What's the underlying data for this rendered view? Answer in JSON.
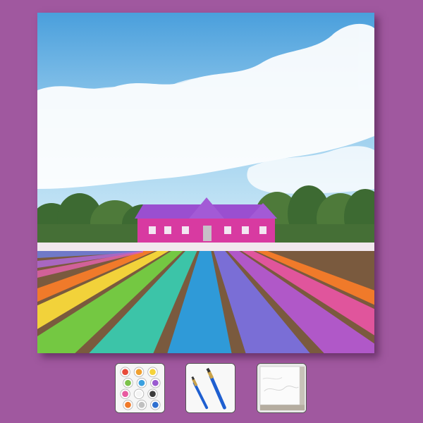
{
  "colors": {
    "background": "#a0589f",
    "sky_top": "#4fa6e0",
    "sky_bottom": "#bfe2f7",
    "house_wall": "#d83aa1",
    "house_roof": "#9a4fd0"
  },
  "main_image": {
    "subject": "house-with-rainbow-flower-field-icon",
    "stripe_colors": [
      "#f07a2a",
      "#f2d23a",
      "#74c842",
      "#3cc4a8",
      "#2f9ad8",
      "#7a6ed6",
      "#b058c8",
      "#e0559c",
      "#f07a2a"
    ]
  },
  "thumbnails": [
    {
      "icon": "paint-pots-icon"
    },
    {
      "icon": "paint-brushes-icon"
    },
    {
      "icon": "canvas-frame-icon"
    }
  ]
}
